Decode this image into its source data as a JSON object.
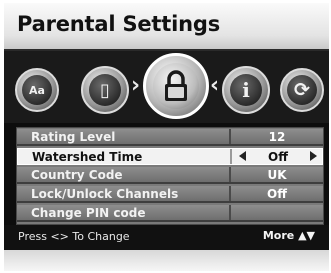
{
  "header": {
    "title": "Parental Settings"
  },
  "icons": [
    {
      "name": "audio-icon",
      "glyph": "Aa",
      "selected": false
    },
    {
      "name": "picture-icon",
      "glyph": "▯",
      "selected": false
    },
    {
      "name": "lock-icon",
      "glyph": "🔒",
      "selected": true
    },
    {
      "name": "info-icon",
      "glyph": "i",
      "selected": false
    },
    {
      "name": "refresh-icon",
      "glyph": "⟳",
      "selected": false
    }
  ],
  "menu": {
    "rows": [
      {
        "label": "Rating Level",
        "value": "12"
      },
      {
        "label": "Watershed Time",
        "value": "Off"
      },
      {
        "label": "Country Code",
        "value": "UK"
      },
      {
        "label": "Lock/Unlock Channels",
        "value": "Off"
      },
      {
        "label": "Change PIN code",
        "value": ""
      }
    ]
  },
  "footer": {
    "hint": "Press <> To Change",
    "more": "More ▲▼"
  }
}
